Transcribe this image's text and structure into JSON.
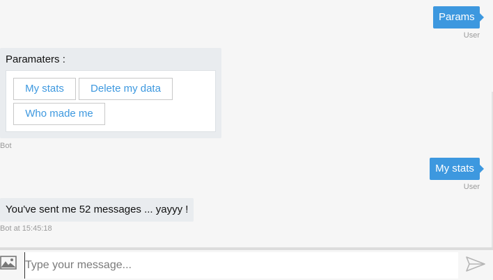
{
  "messages": {
    "user_1": {
      "text": "Params",
      "sender": "User"
    },
    "bot_1": {
      "title": "Paramaters :",
      "options": [
        "My stats",
        "Delete my data",
        "Who made me"
      ],
      "sender": "Bot"
    },
    "user_2": {
      "text": "My stats",
      "sender": "User"
    },
    "bot_2": {
      "text": "You've sent me 52 messages ... yayyy !",
      "meta": "Bot at 15:45:18"
    }
  },
  "composer": {
    "placeholder": "Type your message...",
    "image_icon": "image-icon",
    "send_icon": "send-icon"
  },
  "colors": {
    "accent": "#3d98df",
    "bot_bubble": "#e9ecef",
    "background": "#f6f6f6"
  }
}
